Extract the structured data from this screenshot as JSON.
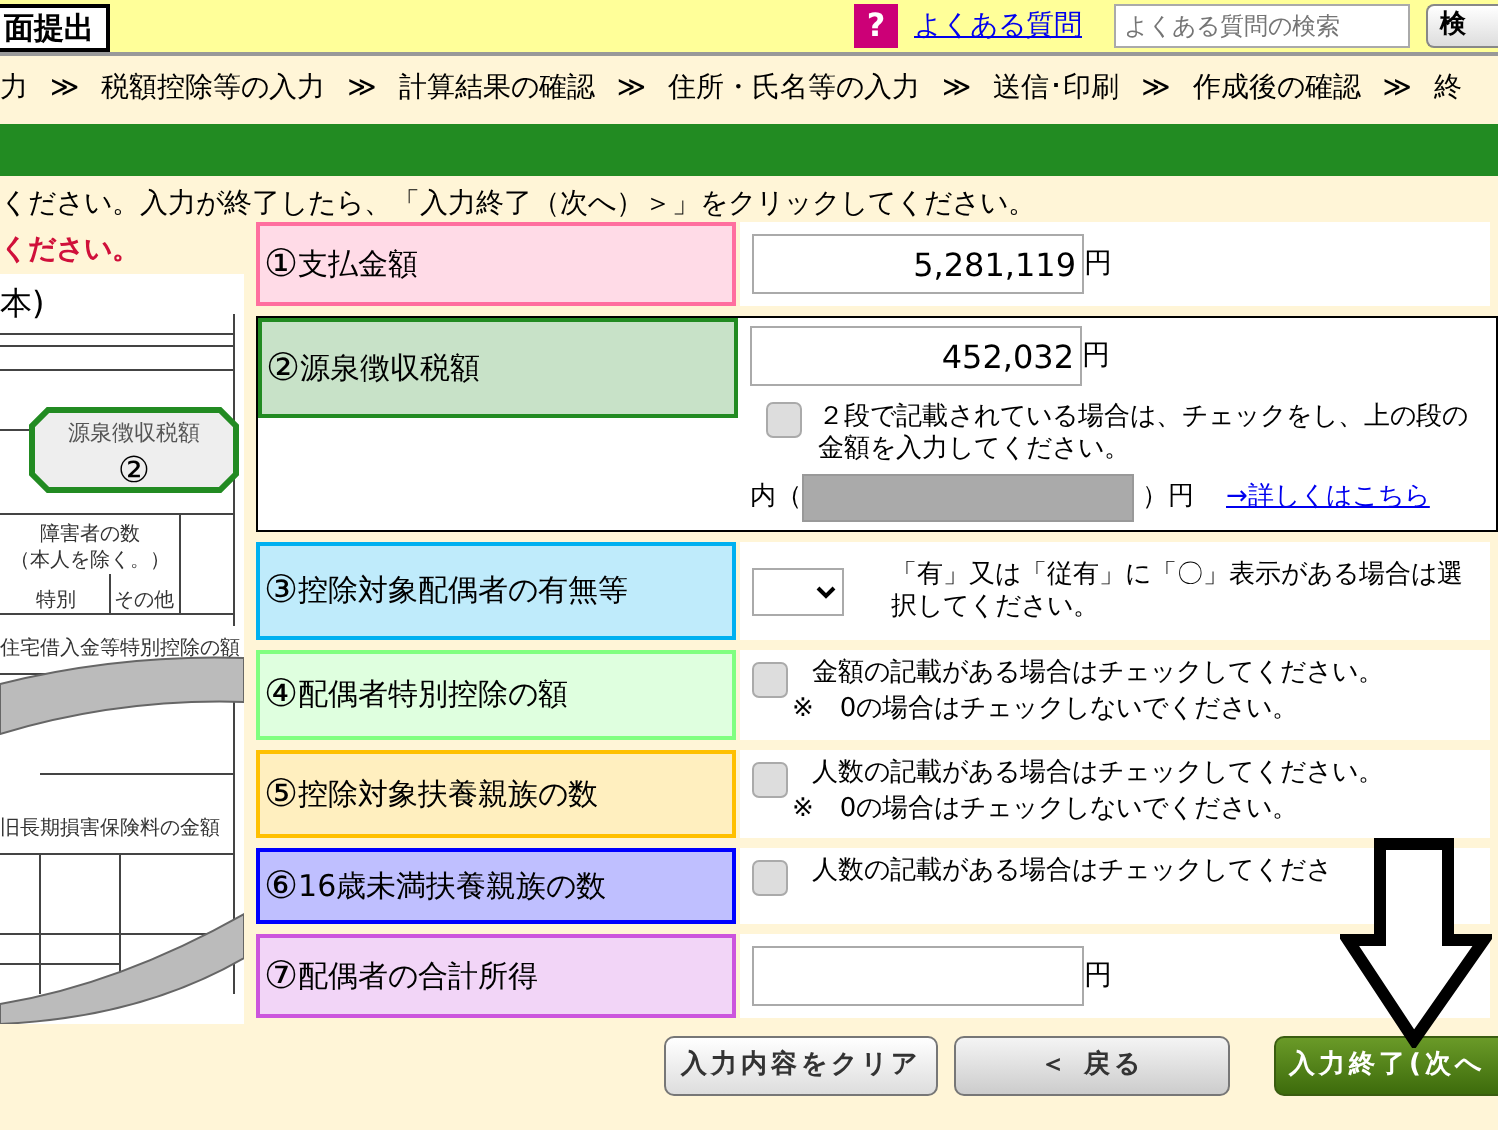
{
  "header": {
    "badge": "面提出",
    "help_icon": "?",
    "faq_link": "よくある質問",
    "search": {
      "placeholder": "よくある質問の検索"
    },
    "search_button": "検"
  },
  "steps": [
    {
      "label": "力",
      "arrow": "≫"
    },
    {
      "label": "税額控除等の入力",
      "arrow": "≫"
    },
    {
      "label": "計算結果の確認",
      "arrow": "≫"
    },
    {
      "label": "住所・氏名等の入力",
      "arrow": "≫"
    },
    {
      "label": "送信･印刷",
      "arrow": "≫"
    },
    {
      "label": "作成後の確認",
      "arrow": "≫"
    },
    {
      "label": "終"
    }
  ],
  "instruction": "ください。入力が終了したら、「入力終了（次へ）＞」をクリックしてください。",
  "warning": "ください。",
  "slip": {
    "title": "本)",
    "highlight_label": "源泉徴収税額",
    "highlight_number": "②",
    "cells": [
      "障害者の数",
      "（本人を除く。）",
      "特別",
      "その他",
      "住宅借入金等特別控除の額",
      "旧長期損害保険料の金額"
    ]
  },
  "rows": [
    {
      "kind": "amount",
      "number": "①",
      "label": "支払金額",
      "color": "#ff6f9f",
      "value": "5,281,119",
      "unit": "円"
    },
    {
      "kind": "split",
      "number": "②",
      "label": "源泉徴収税額",
      "color": "#228b22",
      "value": "452,032",
      "unit": "円",
      "checked": false,
      "text": "２段で記載されている場合は、チェックをし、上の段の金額を入力してください。",
      "inner_prefix": "内（",
      "inner_suffix": "）円",
      "inner_disabled": true,
      "link": "→詳しくはこちら"
    },
    {
      "kind": "select",
      "number": "③",
      "label": "控除対象配偶者の有無等",
      "color": "#00b0f0",
      "text": "「有」又は「従有」に「〇」表示がある場合は選択してください。"
    },
    {
      "kind": "check",
      "number": "④",
      "label": "配偶者特別控除の額",
      "color": "#80ff80",
      "checked": false,
      "text": "金額の記載がある場合はチェックしてください。",
      "note": "※　0の場合はチェックしないでください。"
    },
    {
      "kind": "check",
      "number": "⑤",
      "label": "控除対象扶養親族の数",
      "color": "#ffc000",
      "checked": false,
      "text": "人数の記載がある場合はチェックしてください。",
      "note": "※　0の場合はチェックしないでください。"
    },
    {
      "kind": "check",
      "number": "⑥",
      "label": "16歳未満扶養親族の数",
      "color": "#0000ff",
      "checked": false,
      "text": "人数の記載がある場合はチェックしてくださ"
    },
    {
      "kind": "amount",
      "number": "⑦",
      "label": "配偶者の合計所得",
      "color": "#cc55dd",
      "unit": "円"
    }
  ],
  "buttons": [
    {
      "kind": "clear",
      "label": "入力内容をクリア"
    },
    {
      "kind": "back",
      "label": "＜ 戻る"
    },
    {
      "kind": "next",
      "label": "入力終了(次へ"
    }
  ]
}
